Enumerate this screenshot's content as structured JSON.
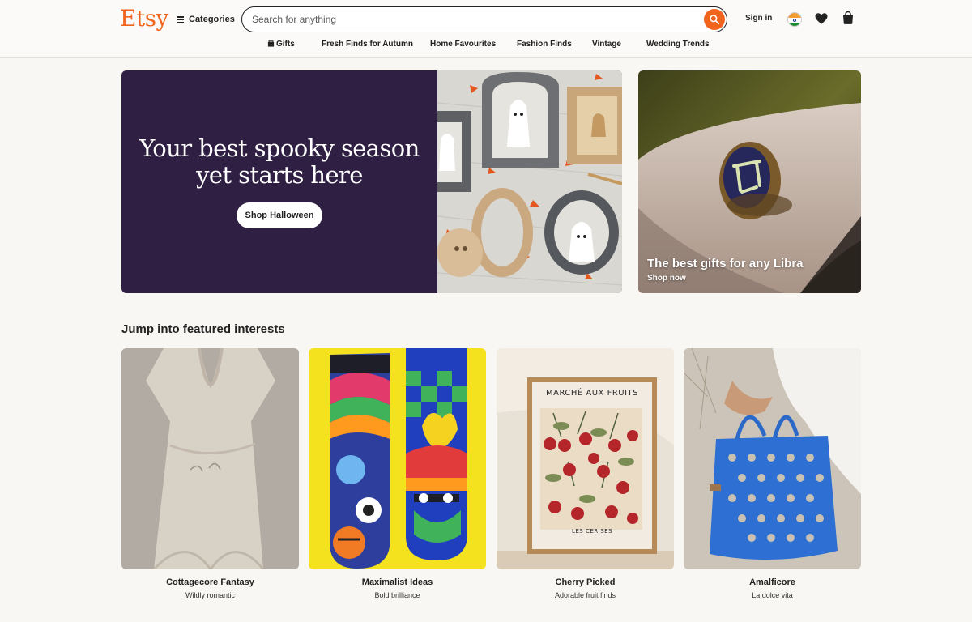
{
  "header": {
    "logo": "Etsy",
    "categories_label": "Categories",
    "search_placeholder": "Search for anything",
    "signin_label": "Sign in"
  },
  "nav": [
    {
      "label": "Gifts"
    },
    {
      "label": "Fresh Finds for Autumn"
    },
    {
      "label": "Home Favourites"
    },
    {
      "label": "Fashion Finds"
    },
    {
      "label": "Vintage"
    },
    {
      "label": "Wedding Trends"
    }
  ],
  "hero": {
    "title": "Your best spooky season yet starts here",
    "button_label": "Shop Halloween"
  },
  "promo": {
    "title": "The best gifts for any Libra",
    "subtitle": "Shop now"
  },
  "featured": {
    "title": "Jump into featured interests",
    "cards": [
      {
        "name": "Cottagecore Fantasy",
        "subtitle": "Wildly romantic"
      },
      {
        "name": "Maximalist Ideas",
        "subtitle": "Bold brilliance"
      },
      {
        "name": "Cherry Picked",
        "subtitle": "Adorable fruit finds"
      },
      {
        "name": "Amalficore",
        "subtitle": "La dolce vita"
      }
    ],
    "poster_title": "MARCHÉ AUX FRUITS",
    "poster_subtitle": "LES CERISES"
  },
  "colors": {
    "brand": "#f1641e",
    "hero_bg": "#2f1f43",
    "page_bg": "#f8f7f4"
  }
}
